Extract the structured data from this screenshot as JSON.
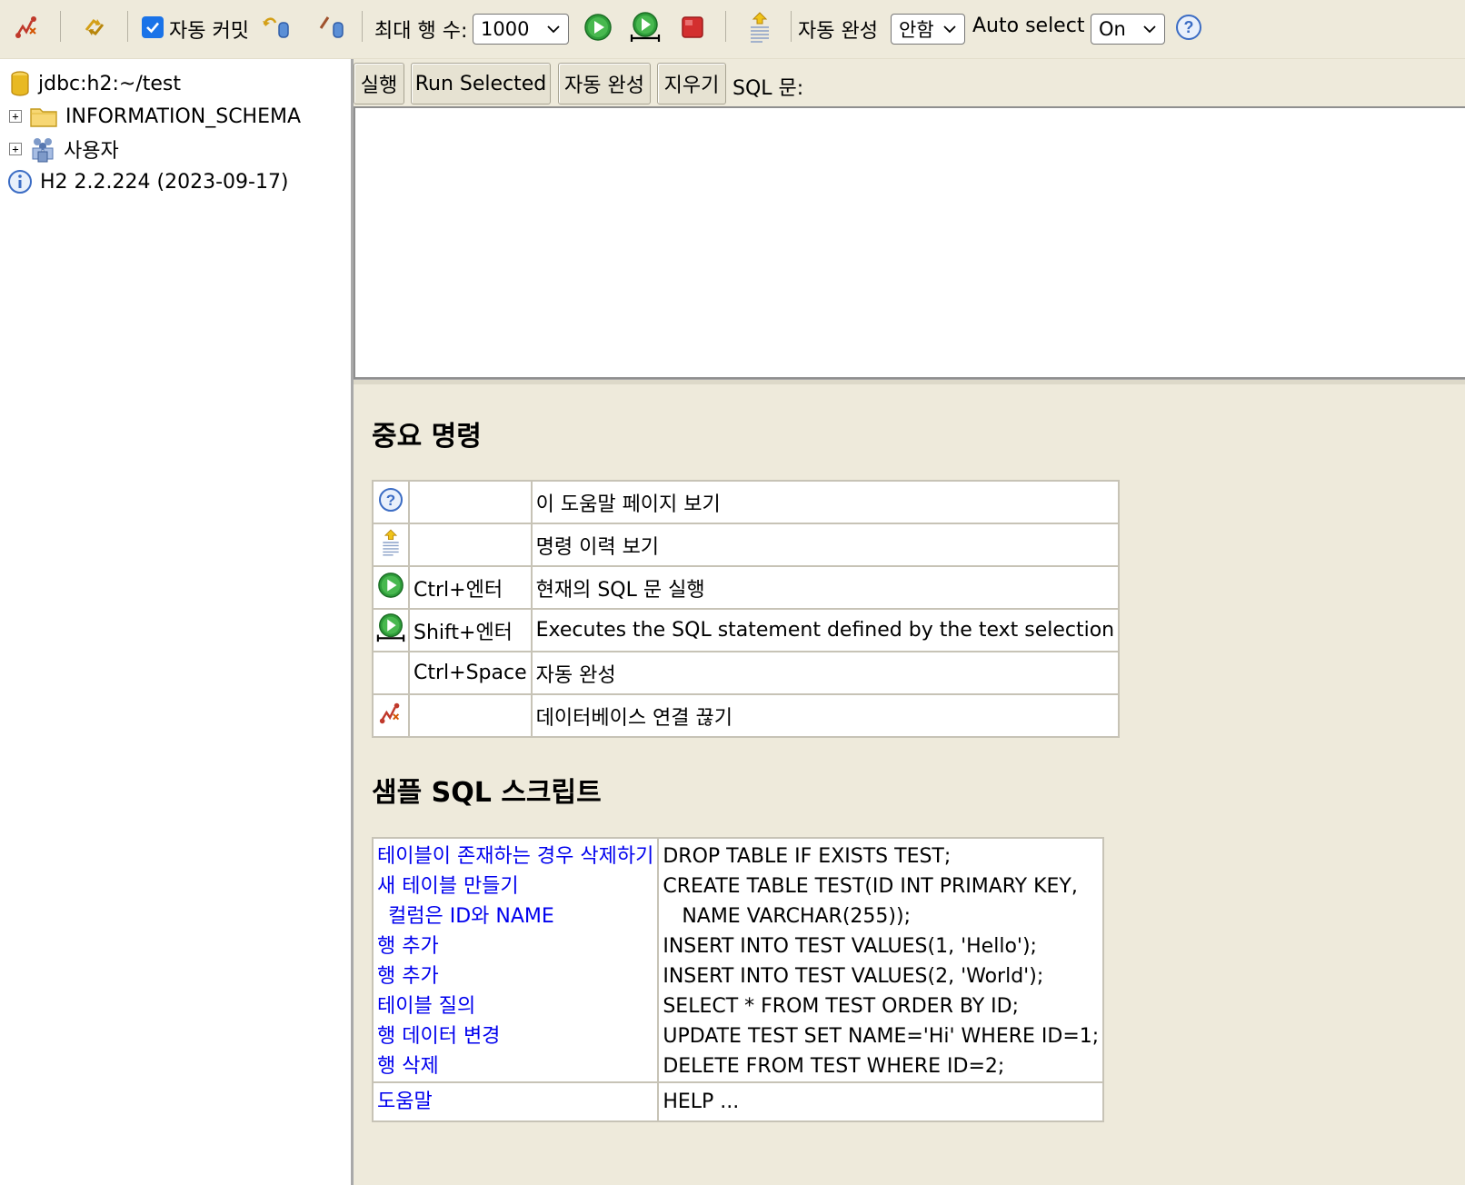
{
  "toolbar": {
    "autocommit_label": "자동 커밋",
    "autocommit_checked": true,
    "max_rows_label": "최대 행 수:",
    "max_rows_value": "1000",
    "autocomplete_label": "자동 완성",
    "autocomplete_value": "안함",
    "autoselect_label": "Auto select",
    "autoselect_value": "On",
    "icons": [
      "disconnect-icon",
      "refresh-icon",
      "rollback-icon",
      "commit-icon",
      "run-icon",
      "run-selected-icon",
      "stop-icon",
      "history-icon",
      "help-icon"
    ]
  },
  "tree": {
    "connection": "jdbc:h2:~/test",
    "nodes": [
      {
        "label": "INFORMATION_SCHEMA",
        "icon": "folder-icon"
      },
      {
        "label": "사용자",
        "icon": "users-icon"
      }
    ],
    "version": "H2 2.2.224 (2023-09-17)"
  },
  "editor": {
    "buttons": {
      "run": "실행",
      "run_selected": "Run Selected",
      "autocomplete": "자동 완성",
      "clear": "지우기"
    },
    "sql_label": "SQL 문:",
    "sql_value": ""
  },
  "help": {
    "important_title": "중요 명령",
    "commands": [
      {
        "icon": "help-icon",
        "key": "",
        "desc": "이 도움말 페이지 보기"
      },
      {
        "icon": "history-icon",
        "key": "",
        "desc": "명령 이력 보기"
      },
      {
        "icon": "run-icon",
        "key": "Ctrl+엔터",
        "desc": "현재의 SQL 문 실행"
      },
      {
        "icon": "run-selected-icon",
        "key": "Shift+엔터",
        "desc": "Executes the SQL statement defined by the text selection"
      },
      {
        "icon": "",
        "key": "Ctrl+Space",
        "desc": "자동 완성"
      },
      {
        "icon": "disconnect-icon",
        "key": "",
        "desc": "데이터베이스 연결 끊기"
      }
    ],
    "sample_title": "샘플 SQL 스크립트",
    "samples": [
      {
        "label": "테이블이 존재하는 경우 삭제하기",
        "sql": "DROP TABLE IF EXISTS TEST;"
      },
      {
        "label": "새 테이블 만들기",
        "sql": "CREATE TABLE TEST(ID INT PRIMARY KEY,"
      },
      {
        "label": "  컬럼은 ID와 NAME",
        "sql": "   NAME VARCHAR(255));"
      },
      {
        "label": "행 추가",
        "sql": "INSERT INTO TEST VALUES(1, 'Hello');"
      },
      {
        "label": "행 추가",
        "sql": "INSERT INTO TEST VALUES(2, 'World');"
      },
      {
        "label": "테이블 질의",
        "sql": "SELECT * FROM TEST ORDER BY ID;"
      },
      {
        "label": "행 데이터 변경",
        "sql": "UPDATE TEST SET NAME='Hi' WHERE ID=1;"
      },
      {
        "label": "행 삭제",
        "sql": "DELETE FROM TEST WHERE ID=2;"
      }
    ],
    "help_row": {
      "label": "도움말",
      "sql": "HELP ..."
    }
  }
}
